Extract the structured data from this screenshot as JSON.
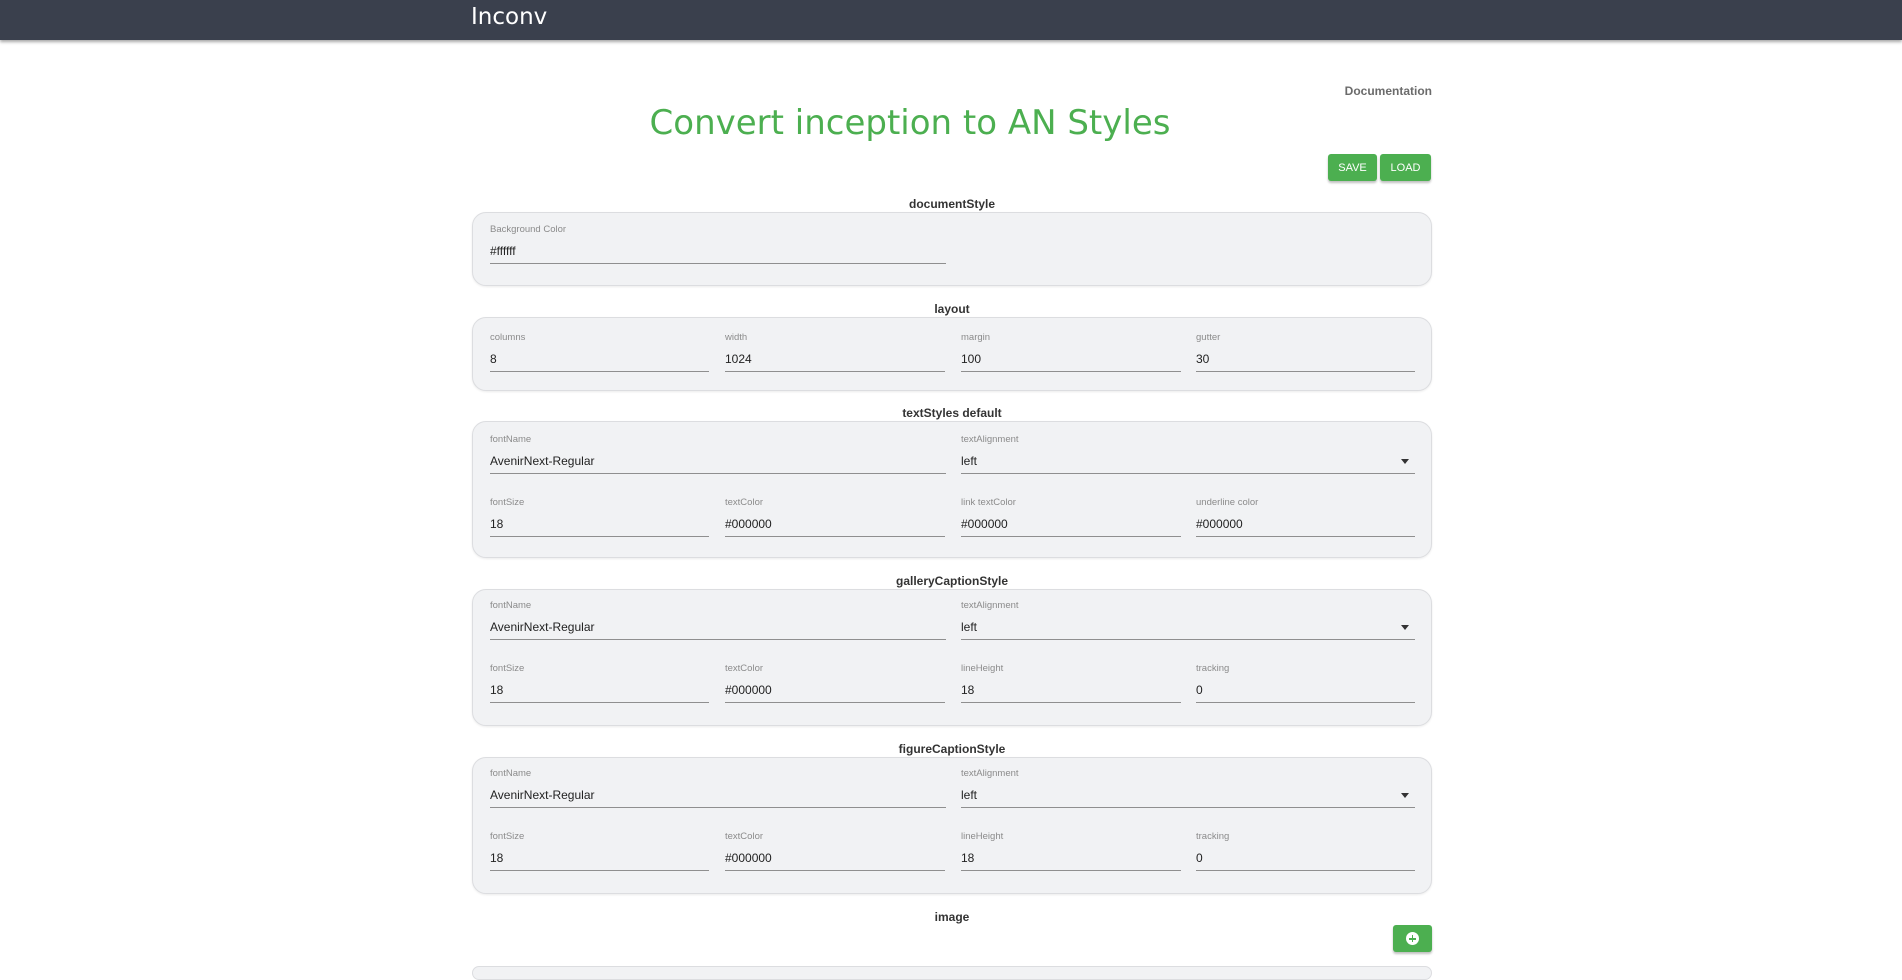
{
  "app": {
    "title": "Inconv"
  },
  "header": {
    "documentation_link": "Documentation",
    "page_title": "Convert inception to AN Styles"
  },
  "toolbar": {
    "save_label": "SAVE",
    "load_label": "LOAD"
  },
  "sections": {
    "documentStyle": {
      "label": "documentStyle",
      "background_color": {
        "label": "Background Color",
        "value": "#ffffff"
      }
    },
    "layout": {
      "label": "layout",
      "columns": {
        "label": "columns",
        "value": "8"
      },
      "width": {
        "label": "width",
        "value": "1024"
      },
      "margin": {
        "label": "margin",
        "value": "100"
      },
      "gutter": {
        "label": "gutter",
        "value": "30"
      }
    },
    "textStyles": {
      "label": "textStyles default",
      "fontName": {
        "label": "fontName",
        "value": "AvenirNext-Regular"
      },
      "textAlignment": {
        "label": "textAlignment",
        "value": "left"
      },
      "fontSize": {
        "label": "fontSize",
        "value": "18"
      },
      "textColor": {
        "label": "textColor",
        "value": "#000000"
      },
      "linkTextColor": {
        "label": "link textColor",
        "value": "#000000"
      },
      "underlineColor": {
        "label": "underline color",
        "value": "#000000"
      }
    },
    "galleryCaptionStyle": {
      "label": "galleryCaptionStyle",
      "fontName": {
        "label": "fontName",
        "value": "AvenirNext-Regular"
      },
      "textAlignment": {
        "label": "textAlignment",
        "value": "left"
      },
      "fontSize": {
        "label": "fontSize",
        "value": "18"
      },
      "textColor": {
        "label": "textColor",
        "value": "#000000"
      },
      "lineHeight": {
        "label": "lineHeight",
        "value": "18"
      },
      "tracking": {
        "label": "tracking",
        "value": "0"
      }
    },
    "figureCaptionStyle": {
      "label": "figureCaptionStyle",
      "fontName": {
        "label": "fontName",
        "value": "AvenirNext-Regular"
      },
      "textAlignment": {
        "label": "textAlignment",
        "value": "left"
      },
      "fontSize": {
        "label": "fontSize",
        "value": "18"
      },
      "textColor": {
        "label": "textColor",
        "value": "#000000"
      },
      "lineHeight": {
        "label": "lineHeight",
        "value": "18"
      },
      "tracking": {
        "label": "tracking",
        "value": "0"
      }
    },
    "image": {
      "label": "image"
    }
  },
  "icons": {
    "add": "plus-circle-icon",
    "dropdown": "caret-down-icon"
  },
  "colors": {
    "accent": "#4caf50",
    "topbar": "#3a404d",
    "card_bg": "#f1f2f4"
  }
}
